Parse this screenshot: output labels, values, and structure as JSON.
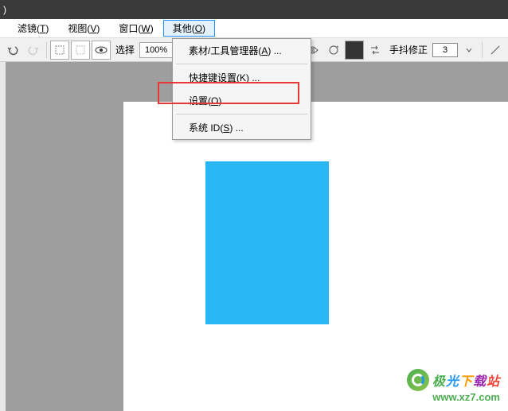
{
  "titlebar": {
    "suffix": ")"
  },
  "menubar": {
    "filter": {
      "label": "滤镜(",
      "key": "T",
      "close": ")"
    },
    "view": {
      "label": "视图(",
      "key": "V",
      "close": ")"
    },
    "window": {
      "label": "窗口(",
      "key": "W",
      "close": ")"
    },
    "other": {
      "label": "其他(",
      "key": "O",
      "close": ")"
    }
  },
  "toolbar": {
    "select_label": "选择",
    "zoom": "100%",
    "stabilize_label": "手抖修正",
    "stabilize_value": "3"
  },
  "dropdown": {
    "material": {
      "label": "素材/工具管理器(",
      "key": "A",
      "close": ") ..."
    },
    "shortcut": {
      "label": "快捷键设置(",
      "key": "K",
      "close": ") ..."
    },
    "settings": {
      "label": "设置(",
      "key": "O",
      "close": ") ..."
    },
    "systemid": {
      "label": "系统 ID(",
      "key": "S",
      "close": ") ..."
    }
  },
  "watermark": {
    "name": "极光下载站",
    "url": "www.xz7.com"
  }
}
